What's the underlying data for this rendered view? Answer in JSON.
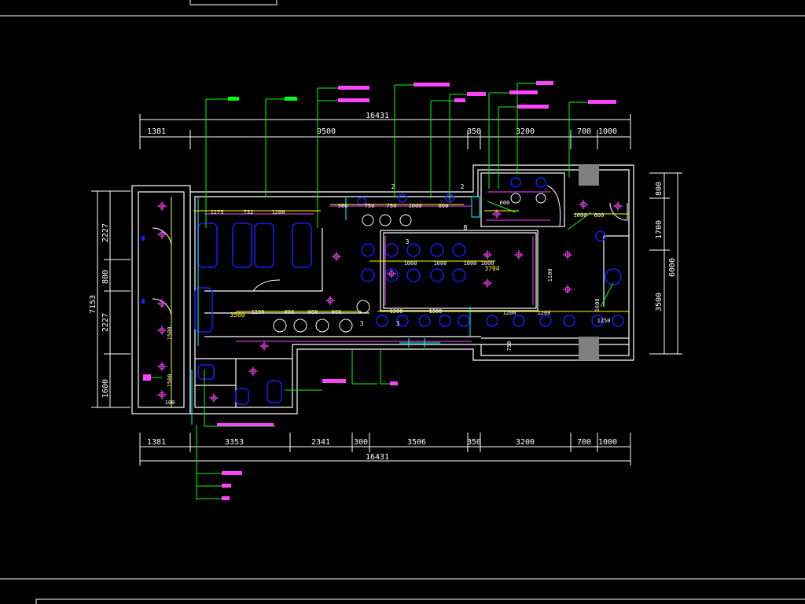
{
  "colors": {
    "background": "#000000",
    "frame": "#ffffff",
    "wall": "#ffffff",
    "dimension": "#ffffff",
    "leader": "#00ff00",
    "lighting": "#ff44ff",
    "fixture": "#1a1aff",
    "annotation": "#ffff00",
    "cyan": "#00ffff",
    "pillar": "#808080",
    "red": "#ff0000"
  },
  "dimensions": {
    "top_total": "16431",
    "bottom_total": "16431",
    "top_segments": [
      "1381",
      "9500",
      "350",
      "3200",
      "700",
      "1000"
    ],
    "bottom_segments": [
      "1381",
      "3353",
      "2341",
      "300",
      "3506",
      "350",
      "3200",
      "700",
      "1000"
    ],
    "left_total": "7153",
    "left_segments": [
      "2227",
      "800",
      "2227",
      "1600"
    ],
    "right_total": "6000",
    "right_segments": [
      "800",
      "1700",
      "3500"
    ]
  },
  "interior_dims": {
    "row_a": [
      "1275",
      "732",
      "1200"
    ],
    "row_b": [
      "960",
      "750",
      "750",
      "1000",
      "800"
    ],
    "table": [
      "1000",
      "1000",
      "1000",
      "1000"
    ],
    "row_c": [
      "1200",
      "800",
      "800",
      "800"
    ],
    "row_d": [
      "1300",
      "1300",
      "1200",
      "1200"
    ],
    "corner_a": "3560",
    "corner_b": "3704",
    "side_a": "1500",
    "side_b": "1500",
    "right_a": "600",
    "right_b": "600",
    "right_c": "1600",
    "right_d": "1100",
    "right_e": "1250",
    "right_f": "1600",
    "stub_a": "100",
    "stub_b": "750"
  },
  "markers": {
    "m1": "3",
    "m2": "3",
    "m3": "3",
    "m4": "B",
    "m5": "2",
    "m6": "2"
  }
}
